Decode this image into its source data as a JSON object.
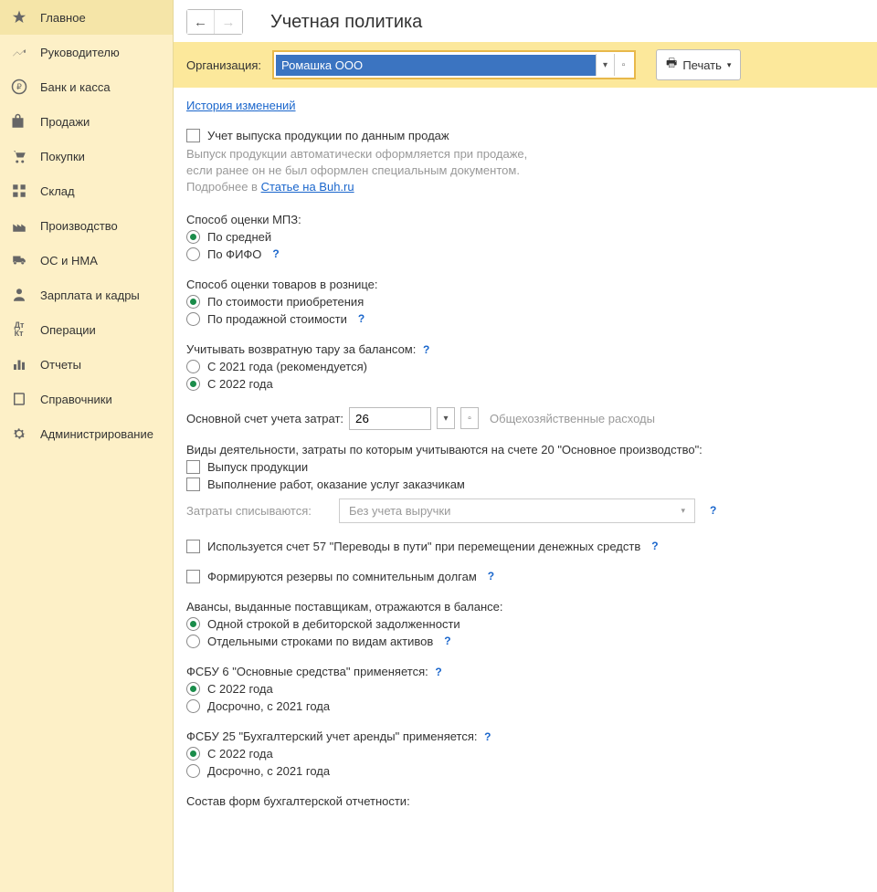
{
  "sidebar": {
    "items": [
      {
        "label": "Главное",
        "icon": "star"
      },
      {
        "label": "Руководителю",
        "icon": "trend"
      },
      {
        "label": "Банк и касса",
        "icon": "ruble"
      },
      {
        "label": "Продажи",
        "icon": "bag"
      },
      {
        "label": "Покупки",
        "icon": "cart"
      },
      {
        "label": "Склад",
        "icon": "boxes"
      },
      {
        "label": "Производство",
        "icon": "factory"
      },
      {
        "label": "ОС и НМА",
        "icon": "truck"
      },
      {
        "label": "Зарплата и кадры",
        "icon": "person"
      },
      {
        "label": "Операции",
        "icon": "dtkt"
      },
      {
        "label": "Отчеты",
        "icon": "chart"
      },
      {
        "label": "Справочники",
        "icon": "book"
      },
      {
        "label": "Администрирование",
        "icon": "gear"
      }
    ]
  },
  "header": {
    "title": "Учетная политика"
  },
  "org": {
    "label": "Организация:",
    "value": "Ромашка ООО",
    "print": "Печать"
  },
  "history_link": "История изменений",
  "cb_release": {
    "label": "Учет выпуска продукции по данным продаж",
    "hint1": "Выпуск продукции автоматически оформляется при продаже,",
    "hint2": "если ранее он не был оформлен специальным документом.",
    "hint3_prefix": "Подробнее в ",
    "hint3_link": "Статье на Buh.ru"
  },
  "mpz": {
    "label": "Способ оценки МПЗ:",
    "o1": "По средней",
    "o2": "По ФИФО"
  },
  "retail": {
    "label": "Способ оценки товаров в рознице:",
    "o1": "По стоимости приобретения",
    "o2": "По продажной стоимости"
  },
  "tara": {
    "label": "Учитывать возвратную тару за балансом:",
    "o1": "С 2021 года (рекомендуется)",
    "o2": "С 2022 года"
  },
  "acct": {
    "label": "Основной счет учета затрат:",
    "value": "26",
    "desc": "Общехозяйственные расходы"
  },
  "activities": {
    "label": "Виды деятельности, затраты по которым учитываются на счете 20 \"Основное производство\":",
    "c1": "Выпуск продукции",
    "c2": "Выполнение работ, оказание услуг заказчикам",
    "writeoff_label": "Затраты списываются:",
    "writeoff_value": "Без учета выручки"
  },
  "cb57": "Используется счет 57 \"Переводы в пути\" при перемещении денежных средств",
  "cbReserve": "Формируются резервы по сомнительным долгам",
  "advances": {
    "label": "Авансы, выданные поставщикам, отражаются в балансе:",
    "o1": "Одной строкой в дебиторской задолженности",
    "o2": "Отдельными строками по видам активов"
  },
  "fsbu6": {
    "label": "ФСБУ 6 \"Основные средства\" применяется:",
    "o1": "С 2022 года",
    "o2": "Досрочно, с 2021 года"
  },
  "fsbu25": {
    "label": "ФСБУ 25 \"Бухгалтерский учет аренды\" применяется:",
    "o1": "С 2022 года",
    "o2": "Досрочно, с 2021 года"
  },
  "report_forms": "Состав форм бухгалтерской отчетности:"
}
